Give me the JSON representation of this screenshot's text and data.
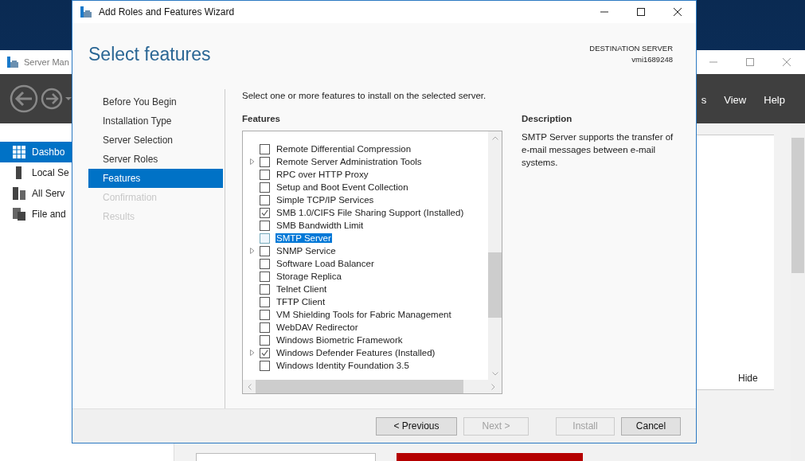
{
  "server_manager": {
    "title": "Server Man",
    "menu": [
      "s",
      "View",
      "Help"
    ],
    "nav": [
      {
        "label": "Dashbo",
        "kind": "dashboard",
        "selected": true
      },
      {
        "label": "Local Se",
        "kind": "server",
        "selected": false
      },
      {
        "label": "All Serv",
        "kind": "servers",
        "selected": false
      },
      {
        "label": "File and",
        "kind": "files",
        "selected": false
      }
    ],
    "panel_link": "Hide"
  },
  "wizard": {
    "title": "Add Roles and Features Wizard",
    "heading": "Select features",
    "destination_label": "DESTINATION SERVER",
    "destination_server": "vmi1689248",
    "steps": [
      {
        "label": "Before You Begin",
        "selected": false,
        "disabled": false
      },
      {
        "label": "Installation Type",
        "selected": false,
        "disabled": false
      },
      {
        "label": "Server Selection",
        "selected": false,
        "disabled": false
      },
      {
        "label": "Server Roles",
        "selected": false,
        "disabled": false
      },
      {
        "label": "Features",
        "selected": true,
        "disabled": false
      },
      {
        "label": "Confirmation",
        "selected": false,
        "disabled": true
      },
      {
        "label": "Results",
        "selected": false,
        "disabled": true
      }
    ],
    "instruction": "Select one or more features to install on the selected server.",
    "features_heading": "Features",
    "features": [
      {
        "label": "Remote Differential Compression",
        "checked": false,
        "expandable": false,
        "selected": false
      },
      {
        "label": "Remote Server Administration Tools",
        "checked": false,
        "expandable": true,
        "selected": false
      },
      {
        "label": "RPC over HTTP Proxy",
        "checked": false,
        "expandable": false,
        "selected": false
      },
      {
        "label": "Setup and Boot Event Collection",
        "checked": false,
        "expandable": false,
        "selected": false
      },
      {
        "label": "Simple TCP/IP Services",
        "checked": false,
        "expandable": false,
        "selected": false
      },
      {
        "label": "SMB 1.0/CIFS File Sharing Support (Installed)",
        "checked": true,
        "expandable": false,
        "selected": false
      },
      {
        "label": "SMB Bandwidth Limit",
        "checked": false,
        "expandable": false,
        "selected": false
      },
      {
        "label": "SMTP Server",
        "checked": false,
        "expandable": false,
        "selected": true
      },
      {
        "label": "SNMP Service",
        "checked": false,
        "expandable": true,
        "selected": false
      },
      {
        "label": "Software Load Balancer",
        "checked": false,
        "expandable": false,
        "selected": false
      },
      {
        "label": "Storage Replica",
        "checked": false,
        "expandable": false,
        "selected": false
      },
      {
        "label": "Telnet Client",
        "checked": false,
        "expandable": false,
        "selected": false
      },
      {
        "label": "TFTP Client",
        "checked": false,
        "expandable": false,
        "selected": false
      },
      {
        "label": "VM Shielding Tools for Fabric Management",
        "checked": false,
        "expandable": false,
        "selected": false
      },
      {
        "label": "WebDAV Redirector",
        "checked": false,
        "expandable": false,
        "selected": false
      },
      {
        "label": "Windows Biometric Framework",
        "checked": false,
        "expandable": false,
        "selected": false
      },
      {
        "label": "Windows Defender Features (Installed)",
        "checked": true,
        "expandable": true,
        "selected": false
      },
      {
        "label": "Windows Identity Foundation 3.5",
        "checked": false,
        "expandable": false,
        "selected": false
      }
    ],
    "description_heading": "Description",
    "description": "SMTP Server supports the transfer of e-mail messages between e-mail systems.",
    "buttons": [
      {
        "label": "< Previous",
        "disabled": false
      },
      {
        "label": "Next >",
        "disabled": true
      },
      {
        "label": "Install",
        "disabled": true
      },
      {
        "label": "Cancel",
        "disabled": false
      }
    ]
  }
}
